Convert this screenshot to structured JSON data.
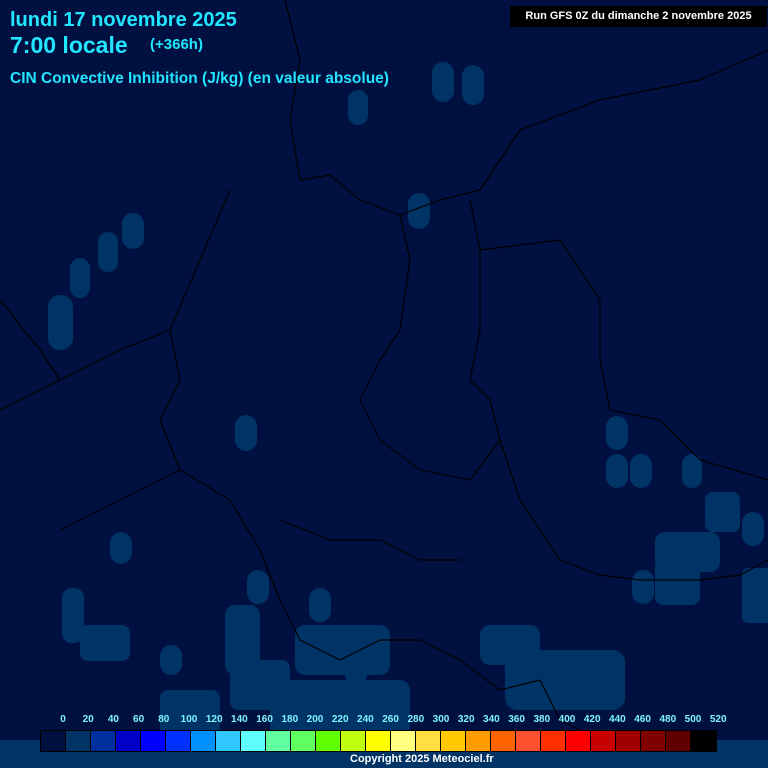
{
  "header": {
    "date": "lundi 17 novembre 2025",
    "time": "7:00 locale",
    "lead": "(+366h)",
    "parameter": "CIN Convective Inhibition (J/kg) (en valeur absolue)",
    "run": "Run GFS 0Z du dimanche 2 novembre 2025"
  },
  "legend": {
    "labels": [
      "0",
      "20",
      "40",
      "60",
      "80",
      "100",
      "120",
      "140",
      "160",
      "180",
      "200",
      "220",
      "240",
      "260",
      "280",
      "300",
      "320",
      "340",
      "360",
      "380",
      "400",
      "420",
      "440",
      "460",
      "480",
      "500",
      "520"
    ],
    "colors": [
      "#001040",
      "#003366",
      "#0030a0",
      "#0000c8",
      "#0000ff",
      "#0030ff",
      "#0090ff",
      "#30c8ff",
      "#60ffff",
      "#60ffa0",
      "#60ff60",
      "#60ff00",
      "#c0ff10",
      "#ffff00",
      "#ffff80",
      "#ffe040",
      "#ffc800",
      "#ff9c00",
      "#ff6400",
      "#ff5030",
      "#ff3000",
      "#ff0000",
      "#c80000",
      "#a00000",
      "#800000",
      "#600000",
      "#000000"
    ]
  },
  "copyright": "Copyright 2025 Meteociel.fr",
  "colors": {
    "background": "#001040",
    "cin_0_20": "#003366",
    "title": "#22e6ff"
  }
}
